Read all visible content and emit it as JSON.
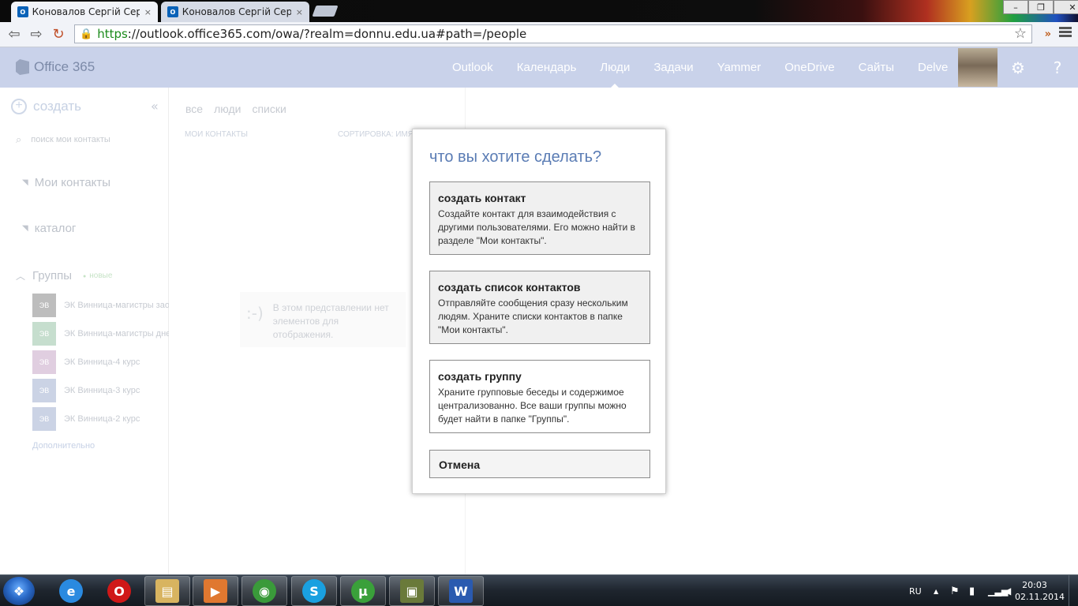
{
  "browser": {
    "tabs": [
      {
        "title": "Коновалов Сергій Сергій",
        "close": "×",
        "favicon": "O"
      },
      {
        "title": "Коновалов Сергій Сергій",
        "close": "×",
        "favicon": "O"
      }
    ],
    "window_controls": {
      "minimize": "–",
      "maximize": "❐",
      "close": "✕"
    },
    "url_scheme": "https",
    "url_rest": "://outlook.office365.com/owa/?realm=donnu.edu.ua#path=/people",
    "back_glyph": "⇦",
    "forward_glyph": "⇨",
    "reload_glyph": "↻",
    "star_glyph": "☆",
    "ext_glyph": "»"
  },
  "header": {
    "brand": "Office 365",
    "nav": [
      "Outlook",
      "Календарь",
      "Люди",
      "Задачи",
      "Yammer",
      "OneDrive",
      "Сайты",
      "Delve"
    ],
    "active_nav": "Люди",
    "settings_glyph": "⚙",
    "help_glyph": "?"
  },
  "sidebar": {
    "create_label": "создать",
    "create_glyph": "+",
    "collapse_glyph": "«",
    "search_placeholder": "поиск мои контакты",
    "folders": [
      {
        "label": "Мои контакты"
      },
      {
        "label": "каталог"
      }
    ],
    "groups_label": "Группы",
    "groups_badge": "новые",
    "groups": [
      {
        "initials": "ЭВ",
        "name": "ЭК Винница-магистры заочники",
        "color": "#9a9a9a"
      },
      {
        "initials": "ЭВ",
        "name": "ЭК Винница-магистры дневники",
        "color": "#a8ccb4"
      },
      {
        "initials": "ЭВ",
        "name": "ЭК Винница-4 курс",
        "color": "#d0b4d0"
      },
      {
        "initials": "ЭВ",
        "name": "ЭК Винница-3 курс",
        "color": "#b0bcd8"
      },
      {
        "initials": "ЭВ",
        "name": "ЭК Винница-2 курс",
        "color": "#b0bcd8"
      }
    ],
    "more_label": "Дополнительно"
  },
  "list": {
    "filters": [
      "все",
      "люди",
      "списки"
    ],
    "section_label": "МОИ КОНТАКТЫ",
    "sort_label": "СОРТИРОВКА: ИМЯ",
    "empty_face": ":-)",
    "empty_text": "В этом представлении нет элементов для отображения."
  },
  "dialog": {
    "title": "что вы хотите сделать?",
    "options": [
      {
        "title": "создать контакт",
        "description": "Создайте контакт для взаимодействия с другими пользователями. Его можно найти в разделе \"Мои контакты\"."
      },
      {
        "title": "создать список контактов",
        "description": "Отправляйте сообщения сразу нескольким людям. Храните списки контактов в папке \"Мои контакты\"."
      },
      {
        "title": "создать группу",
        "description": "Храните групповые беседы и содержимое централизованно. Все ваши группы можно будет найти в папке \"Группы\"."
      }
    ],
    "cancel_label": "Отмена"
  },
  "taskbar": {
    "apps": [
      {
        "name": "internet-explorer-icon",
        "glyph": "e",
        "color": "#2a8ae0",
        "state": "pinned"
      },
      {
        "name": "opera-icon",
        "glyph": "O",
        "color": "#d01818",
        "state": "pinned"
      },
      {
        "name": "file-explorer-icon",
        "glyph": "▤",
        "color": "#d8b460",
        "state": "running"
      },
      {
        "name": "media-player-icon",
        "glyph": "▶",
        "color": "#e07830",
        "state": "running"
      },
      {
        "name": "chrome-icon",
        "glyph": "◉",
        "color": "#3a9a3a",
        "state": "running"
      },
      {
        "name": "skype-icon",
        "glyph": "S",
        "color": "#1aa0e0",
        "state": "running"
      },
      {
        "name": "utorrent-icon",
        "glyph": "µ",
        "color": "#3aa03a",
        "state": "running"
      },
      {
        "name": "network-tool-icon",
        "glyph": "▣",
        "color": "#6a7a3a",
        "state": "running"
      },
      {
        "name": "word-icon",
        "glyph": "W",
        "color": "#2a5ab0",
        "state": "running"
      }
    ],
    "start_glyph": "❖",
    "lang": "RU",
    "tray_arrow": "▲",
    "time": "20:03",
    "date": "02.11.2014"
  }
}
